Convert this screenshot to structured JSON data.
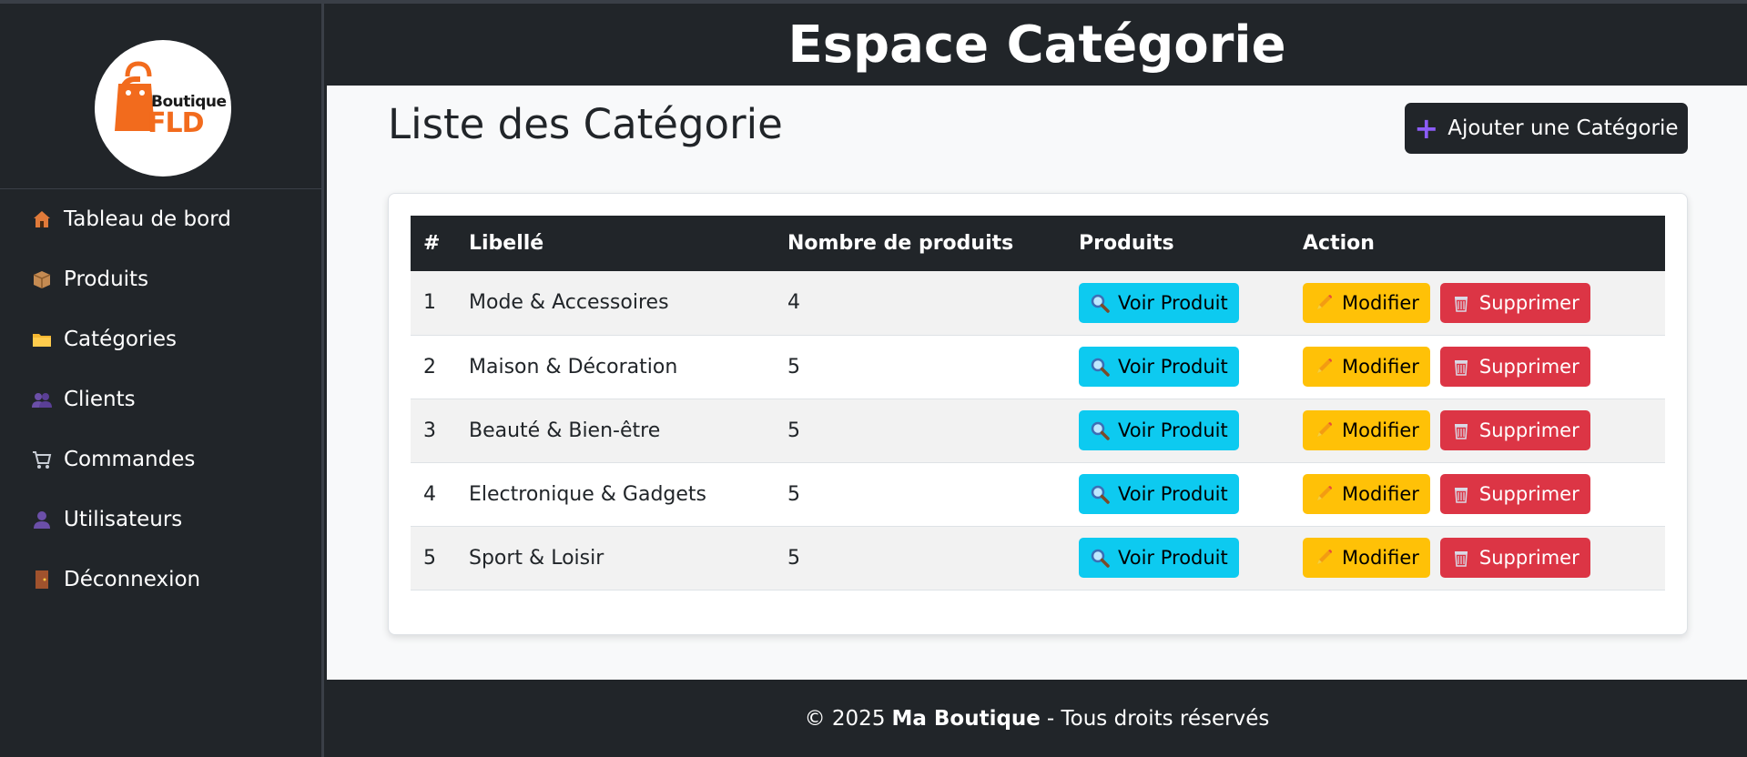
{
  "brand": {
    "logo_top": "Boutique",
    "logo_bottom": "FLD",
    "logo_orange": "#f26b1d"
  },
  "sidebar": {
    "items": [
      {
        "label": "Tableau de bord",
        "icon": "house-icon"
      },
      {
        "label": "Produits",
        "icon": "package-icon"
      },
      {
        "label": "Catégories",
        "icon": "folder-icon"
      },
      {
        "label": "Clients",
        "icon": "users-icon"
      },
      {
        "label": "Commandes",
        "icon": "cart-icon"
      },
      {
        "label": "Utilisateurs",
        "icon": "user-icon"
      },
      {
        "label": "Déconnexion",
        "icon": "door-icon"
      }
    ]
  },
  "header": {
    "title": "Espace Catégorie"
  },
  "main": {
    "page_title": "Liste des Catégorie",
    "add_button_label": "Ajouter une Catégorie"
  },
  "table": {
    "columns": [
      "#",
      "Libellé",
      "Nombre de produits",
      "Produits",
      "Action"
    ],
    "rows": [
      {
        "id": "1",
        "label": "Mode & Accessoires",
        "count": "4"
      },
      {
        "id": "2",
        "label": "Maison & Décoration",
        "count": "5"
      },
      {
        "id": "3",
        "label": "Beauté & Bien-être",
        "count": "5"
      },
      {
        "id": "4",
        "label": "Electronique & Gadgets",
        "count": "5"
      },
      {
        "id": "5",
        "label": "Sport & Loisir",
        "count": "5"
      }
    ],
    "view_label": "Voir Produit",
    "edit_label": "Modifier",
    "delete_label": "Supprimer"
  },
  "footer": {
    "prefix": "© 2025",
    "brand": "Ma Boutique",
    "suffix": "- Tous droits réservés"
  },
  "colors": {
    "dark": "#212529",
    "info": "#0dcaf0",
    "warning": "#ffc107",
    "danger": "#dc3545",
    "accent_plus": "#8b5cf6"
  }
}
